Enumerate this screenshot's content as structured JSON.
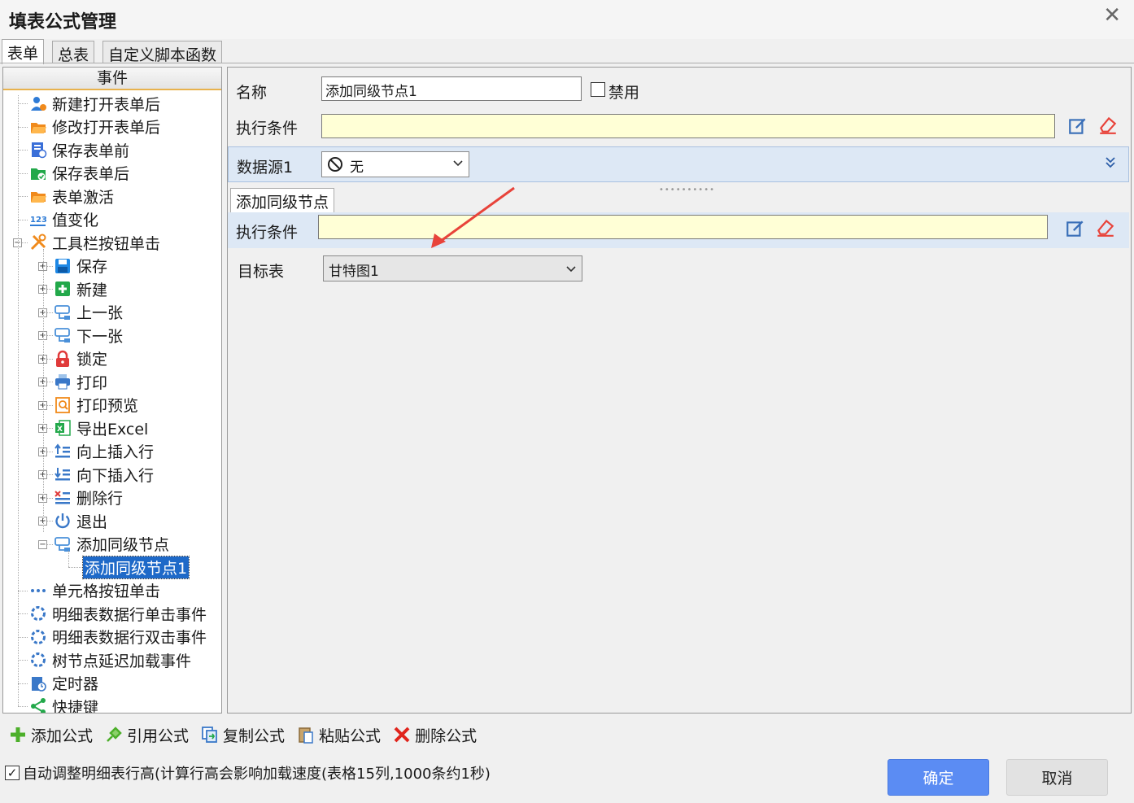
{
  "window": {
    "title": "填表公式管理",
    "close": "✕"
  },
  "tabs": [
    "表单",
    "总表",
    "自定义脚本函数"
  ],
  "tree": {
    "header": "事件",
    "items": [
      {
        "label": "新建打开表单后",
        "icon": "user-add-icon",
        "color": "#2e7bd6"
      },
      {
        "label": "修改打开表单后",
        "icon": "folder-open-icon",
        "color": "#f08a1c"
      },
      {
        "label": "保存表单前",
        "icon": "save-check-icon",
        "color": "#3a6fd8"
      },
      {
        "label": "保存表单后",
        "icon": "folder-check-icon",
        "color": "#22a84a"
      },
      {
        "label": "表单激活",
        "icon": "folder-open-icon",
        "color": "#f08a1c"
      },
      {
        "label": "值变化",
        "icon": "123-icon",
        "color": "#2e7bd6"
      },
      {
        "label": "工具栏按钮单击",
        "icon": "tools-icon",
        "color": "#f08a1c"
      },
      {
        "label": "保存",
        "icon": "floppy-icon",
        "color": "#1e88e5"
      },
      {
        "label": "新建",
        "icon": "plus-square-icon",
        "color": "#22a84a"
      },
      {
        "label": "上一张",
        "icon": "node-icon",
        "color": "#4a90d9"
      },
      {
        "label": "下一张",
        "icon": "node-icon",
        "color": "#4a90d9"
      },
      {
        "label": "锁定",
        "icon": "lock-icon",
        "color": "#e03a3a"
      },
      {
        "label": "打印",
        "icon": "printer-icon",
        "color": "#3a78c8"
      },
      {
        "label": "打印预览",
        "icon": "print-preview-icon",
        "color": "#f08a1c"
      },
      {
        "label": "导出Excel",
        "icon": "excel-icon",
        "color": "#22a84a"
      },
      {
        "label": "向上插入行",
        "icon": "insert-up-icon",
        "color": "#3a78c8"
      },
      {
        "label": "向下插入行",
        "icon": "insert-down-icon",
        "color": "#3a78c8"
      },
      {
        "label": "删除行",
        "icon": "delete-row-icon",
        "color": "#3a78c8"
      },
      {
        "label": "退出",
        "icon": "power-icon",
        "color": "#3a78c8"
      },
      {
        "label": "添加同级节点",
        "icon": "node-icon",
        "color": "#4a90d9"
      },
      {
        "label": "添加同级节点1",
        "icon": "",
        "color": ""
      },
      {
        "label": "单元格按钮单击",
        "icon": "dots-icon",
        "color": "#3a78c8"
      },
      {
        "label": "明细表数据行单击事件",
        "icon": "ring-icon",
        "color": "#3a78c8"
      },
      {
        "label": "明细表数据行双击事件",
        "icon": "ring-icon",
        "color": "#3a78c8"
      },
      {
        "label": "树节点延迟加载事件",
        "icon": "ring-icon",
        "color": "#3a78c8"
      },
      {
        "label": "定时器",
        "icon": "timer-icon",
        "color": "#3a78c8"
      },
      {
        "label": "快捷键",
        "icon": "share-icon",
        "color": "#22a84a"
      }
    ]
  },
  "form": {
    "name_label": "名称",
    "name_value": "添加同级节点1",
    "disable_label": "禁用",
    "condition_label": "执行条件",
    "datasource_label": "数据源1",
    "datasource_value": "无",
    "subtab_label": "添加同级节点",
    "sub_condition_label": "执行条件",
    "target_label": "目标表",
    "target_value": "甘特图1"
  },
  "toolbar": {
    "add": "添加公式",
    "ref": "引用公式",
    "copy": "复制公式",
    "paste": "粘贴公式",
    "delete": "删除公式"
  },
  "footer": {
    "auto_adjust": "自动调整明细表行高(计算行高会影响加载速度(表格15列,1000条约1秒)",
    "ok": "确定",
    "cancel": "取消"
  },
  "colors": {
    "accent": "#5b8cf3",
    "selected": "#1e69c8",
    "arrow": "#e8433a"
  }
}
